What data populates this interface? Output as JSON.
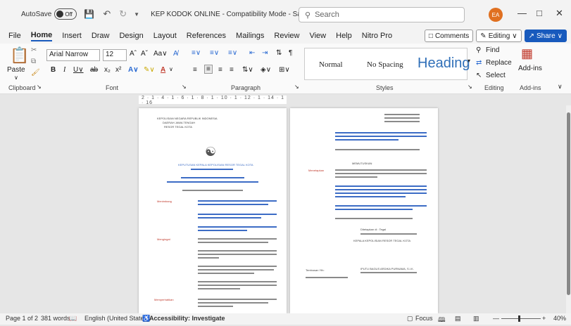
{
  "titlebar": {
    "autosave": "AutoSave",
    "toggle": "Off",
    "doc_title": "KEP KODOK ONLINE - Compatibility Mode - Saved",
    "search_placeholder": "Search",
    "avatar_initials": "EA"
  },
  "menu": {
    "items": [
      "File",
      "Home",
      "Insert",
      "Draw",
      "Design",
      "Layout",
      "References",
      "Mailings",
      "Review",
      "View",
      "Help",
      "Nitro Pro"
    ],
    "active": "Home",
    "comments": "Comments",
    "editing": "Editing",
    "share": "Share"
  },
  "ribbon": {
    "clipboard": {
      "paste": "Paste",
      "label": "Clipboard"
    },
    "font": {
      "name": "Arial Narrow",
      "size": "12",
      "label": "Font"
    },
    "paragraph": {
      "label": "Paragraph"
    },
    "styles": {
      "normal": "Normal",
      "no_spacing": "No Spacing",
      "heading": "Heading",
      "label": "Styles"
    },
    "editing": {
      "find": "Find",
      "replace": "Replace",
      "select": "Select",
      "label": "Editing"
    },
    "addins": {
      "name": "Add-ins",
      "label": "Add-ins"
    }
  },
  "ruler": {
    "text": "2 · 1 · 4 · 1 · 6 · 1 · 8 · 1 · 10 · 1 · 12 · 1 · 14 · 1 · 16"
  },
  "page1": {
    "header": "KEPOLISIAN NEGARA REPUBLIK INDONESIA",
    "sub1": "DAERAH JAWA TENGAH",
    "sub2": "RESOR TEGAL KOTA",
    "title": "KEPUTUSAN KEPALA KEPOLISIAN RESOR TEGAL KOTA",
    "menimbang": "Menimbang",
    "mengingat": "Mengingat",
    "memperhatikan": "Memperhatikan"
  },
  "page2": {
    "memutuskan": "MEMUTUSKAN",
    "menetapkan": "Menetapkan",
    "ditetapkan": "Ditetapkan di : Tegal",
    "kapolres": "KEPALA KEPOLISIAN RESOR TEGAL KOTA",
    "signer": "IPUTU BAGUS ARDIKA PURNAMA, S.I.K.",
    "tembusan": "Tembusan Yth:"
  },
  "status": {
    "page": "Page 1 of 2",
    "words": "381 words",
    "language": "English (United States)",
    "accessibility": "Accessibility: Investigate",
    "focus": "Focus",
    "zoom": "40%"
  }
}
